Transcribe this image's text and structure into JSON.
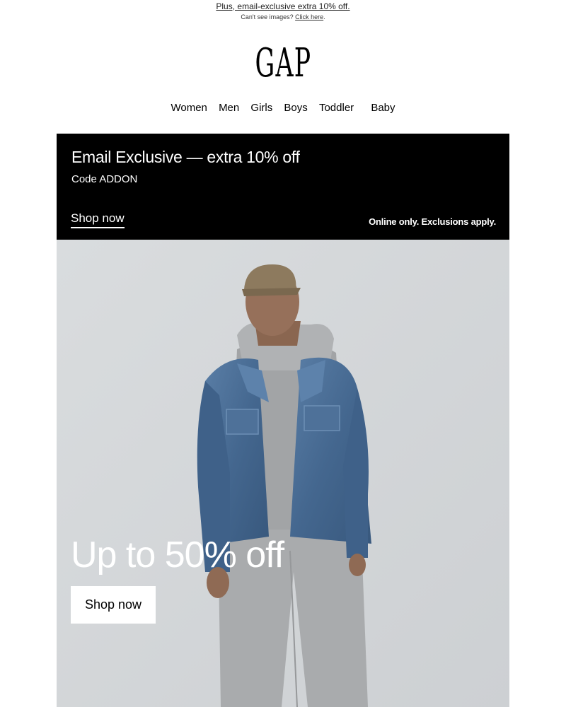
{
  "preheader": {
    "headline": "Plus, email-exclusive extra 10% off.",
    "images_text": "Can't see images?",
    "images_link": "Click here"
  },
  "brand": {
    "logo_text": "GAP"
  },
  "nav": {
    "items": [
      "Women",
      "Men",
      "Girls",
      "Boys",
      "Toddler",
      "Baby"
    ]
  },
  "promo": {
    "title": "Email Exclusive — extra 10% off",
    "code": "Code ADDON",
    "cta": "Shop now",
    "note": "Online only. Exclusions apply."
  },
  "hero": {
    "headline": "Up to 50% off",
    "cta": "Shop now"
  },
  "colors": {
    "promo_bg": "#000000",
    "hero_bg": "#d5d8da",
    "denim": "#4b6e96",
    "hoodie": "#9fa1a3"
  }
}
